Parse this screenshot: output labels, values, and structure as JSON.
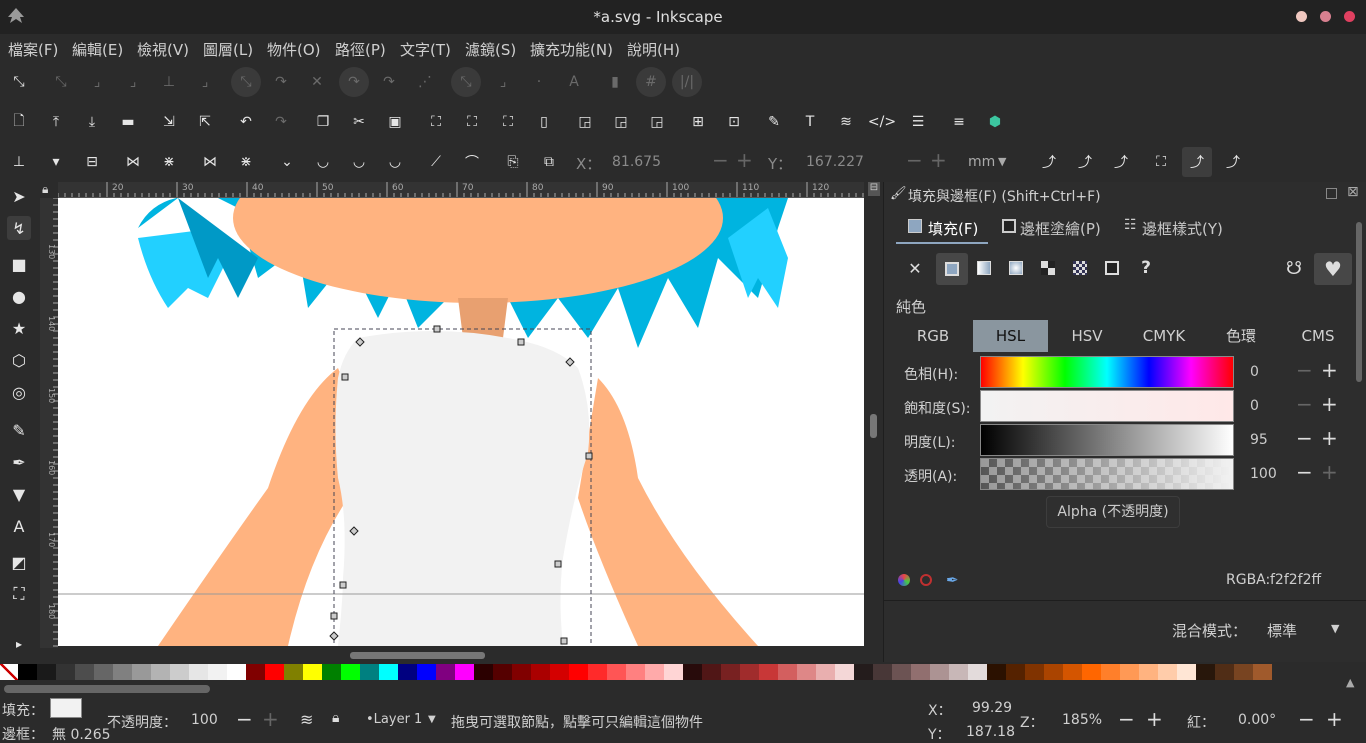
{
  "window": {
    "title": "*a.svg - Inkscape"
  },
  "menu": [
    "檔案(F)",
    "編輯(E)",
    "檢視(V)",
    "圖層(L)",
    "物件(O)",
    "路徑(P)",
    "文字(T)",
    "濾鏡(S)",
    "擴充功能(N)",
    "說明(H)"
  ],
  "node_toolbar": {
    "x_label": "X：",
    "x_value": "81.675",
    "y_label": "Y：",
    "y_value": "167.227",
    "unit": "mm"
  },
  "rulers": {
    "h_labels": [
      "20",
      "30",
      "40",
      "50",
      "60",
      "70",
      "80",
      "90",
      "100",
      "110",
      "120"
    ],
    "v_labels": [
      "130",
      "140",
      "150",
      "160",
      "170",
      "180"
    ]
  },
  "panel": {
    "title": "填充與邊框(F) (Shift+Ctrl+F)",
    "tabs": [
      "填充(F)",
      "邊框塗繪(P)",
      "邊框樣式(Y)"
    ],
    "paint_type_label": "純色",
    "color_modes": [
      "RGB",
      "HSL",
      "HSV",
      "CMYK",
      "色環",
      "CMS"
    ],
    "active_mode": "HSL",
    "sliders": [
      {
        "label": "色相(H):",
        "value": "0"
      },
      {
        "label": "飽和度(S):",
        "value": "0"
      },
      {
        "label": "明度(L):",
        "value": "95"
      },
      {
        "label": "透明(A):",
        "value": "100"
      }
    ],
    "tooltip": "Alpha (不透明度)",
    "rgba_label": "RGBA:",
    "rgba_value": "f2f2f2ff",
    "blend_label": "混合模式：",
    "blend_value": "標準"
  },
  "palette_colors": [
    "#000000",
    "#1a1a1a",
    "#333333",
    "#4d4d4d",
    "#666666",
    "#808080",
    "#999999",
    "#b3b3b3",
    "#cccccc",
    "#e6e6e6",
    "#f2f2f2",
    "#ffffff",
    "#800000",
    "#ff0000",
    "#808000",
    "#ffff00",
    "#008000",
    "#00ff00",
    "#008080",
    "#00ffff",
    "#000080",
    "#0000ff",
    "#800080",
    "#ff00ff",
    "#2b0000",
    "#550000",
    "#800000",
    "#aa0000",
    "#d40000",
    "#ff0000",
    "#ff2a2a",
    "#ff5555",
    "#ff8080",
    "#ffaaaa",
    "#ffd5d5",
    "#280b0b",
    "#501616",
    "#782121",
    "#a02c2c",
    "#c83737",
    "#d35f5f",
    "#de8787",
    "#e9afaf",
    "#f4d7d7",
    "#241c1c",
    "#483737",
    "#6c5353",
    "#916f6f",
    "#ac9393",
    "#c8b7b7",
    "#e3dbdb",
    "#2b1100",
    "#552200",
    "#803300",
    "#aa4400",
    "#d45500",
    "#ff6600",
    "#ff7f2a",
    "#ff9955",
    "#ffb380",
    "#ffccaa",
    "#ffe6d5",
    "#28170b",
    "#502d16",
    "#784421",
    "#a05a2c"
  ],
  "status": {
    "fill_label": "填充：",
    "stroke_label": "邊框：",
    "stroke_value": "無 0.265",
    "opacity_label": "不透明度：",
    "opacity_value": "100",
    "layer": "•Layer 1",
    "message": "拖曳可選取節點，點擊可只編輯這個物件",
    "x_label": "X：",
    "x_value": "99.29",
    "y_label": "Y：",
    "y_value": "187.18",
    "zoom_label": "Z：",
    "zoom_value": "185%",
    "rotate_label": "紅：",
    "rotate_value": "0.00°"
  },
  "colors": {
    "hair": "#00b4e0",
    "hair_light": "#22d0ff",
    "skin": "#ffb380",
    "dress": "#f2f2f2",
    "accent_tab": "#8ea6c0"
  }
}
